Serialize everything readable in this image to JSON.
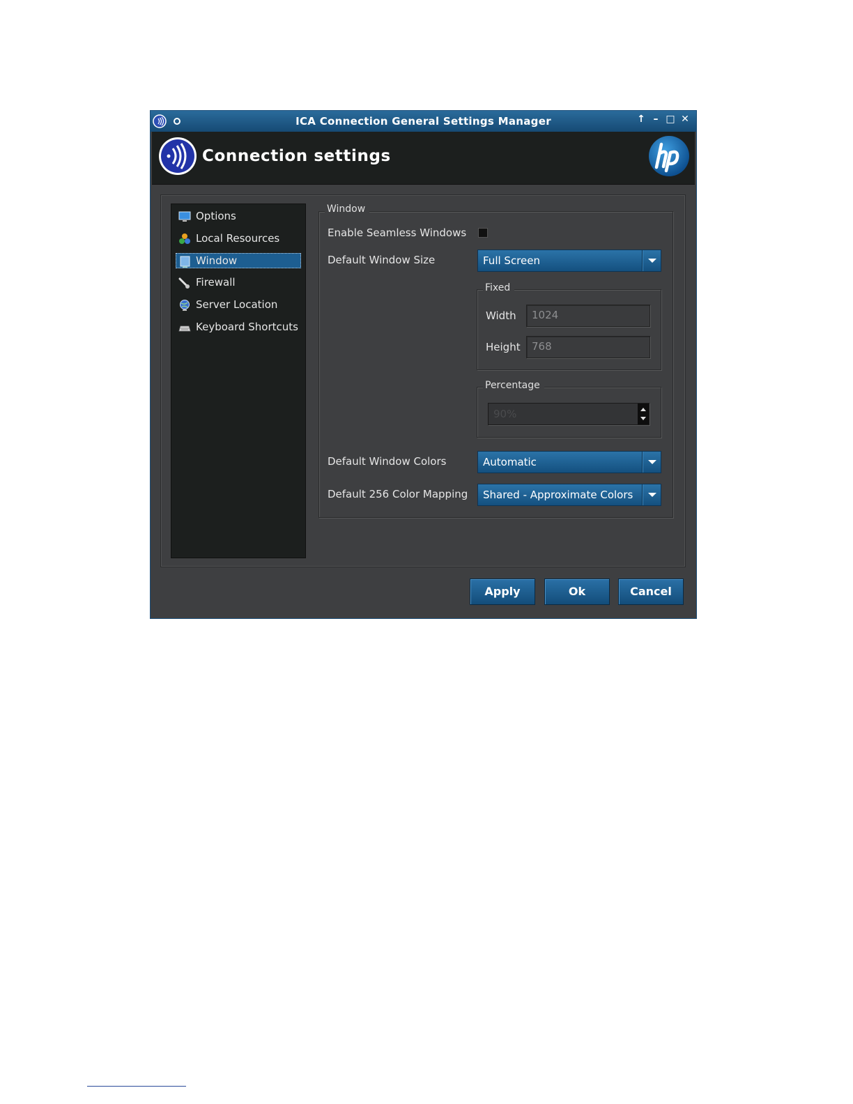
{
  "window": {
    "title": "ICA Connection General Settings Manager",
    "controls": [
      "↑",
      "–",
      "□",
      "✕"
    ]
  },
  "header": {
    "title": "Connection settings"
  },
  "sidebar": {
    "items": [
      {
        "label": "Options",
        "icon": "monitor-icon"
      },
      {
        "label": "Local Resources",
        "icon": "resources-icon"
      },
      {
        "label": "Window",
        "icon": "window-icon",
        "selected": true
      },
      {
        "label": "Firewall",
        "icon": "firewall-icon"
      },
      {
        "label": "Server Location",
        "icon": "globe-icon"
      },
      {
        "label": "Keyboard Shortcuts",
        "icon": "keyboard-icon"
      }
    ]
  },
  "window_group": {
    "title": "Window",
    "seamless_label": "Enable Seamless Windows",
    "seamless_checked": false,
    "size_label": "Default Window Size",
    "size_value": "Full Screen",
    "fixed": {
      "title": "Fixed",
      "width_label": "Width",
      "width_value": "1024",
      "height_label": "Height",
      "height_value": "768"
    },
    "percentage": {
      "title": "Percentage",
      "value": "90%"
    },
    "colors_label": "Default Window Colors",
    "colors_value": "Automatic",
    "mapping_label": "Default 256 Color Mapping",
    "mapping_value": "Shared - Approximate Colors"
  },
  "buttons": {
    "apply": "Apply",
    "ok": "Ok",
    "cancel": "Cancel"
  },
  "colors": {
    "accent": "#1d5e91",
    "background": "#3e3f41",
    "sidebar": "#1c1f1e"
  }
}
